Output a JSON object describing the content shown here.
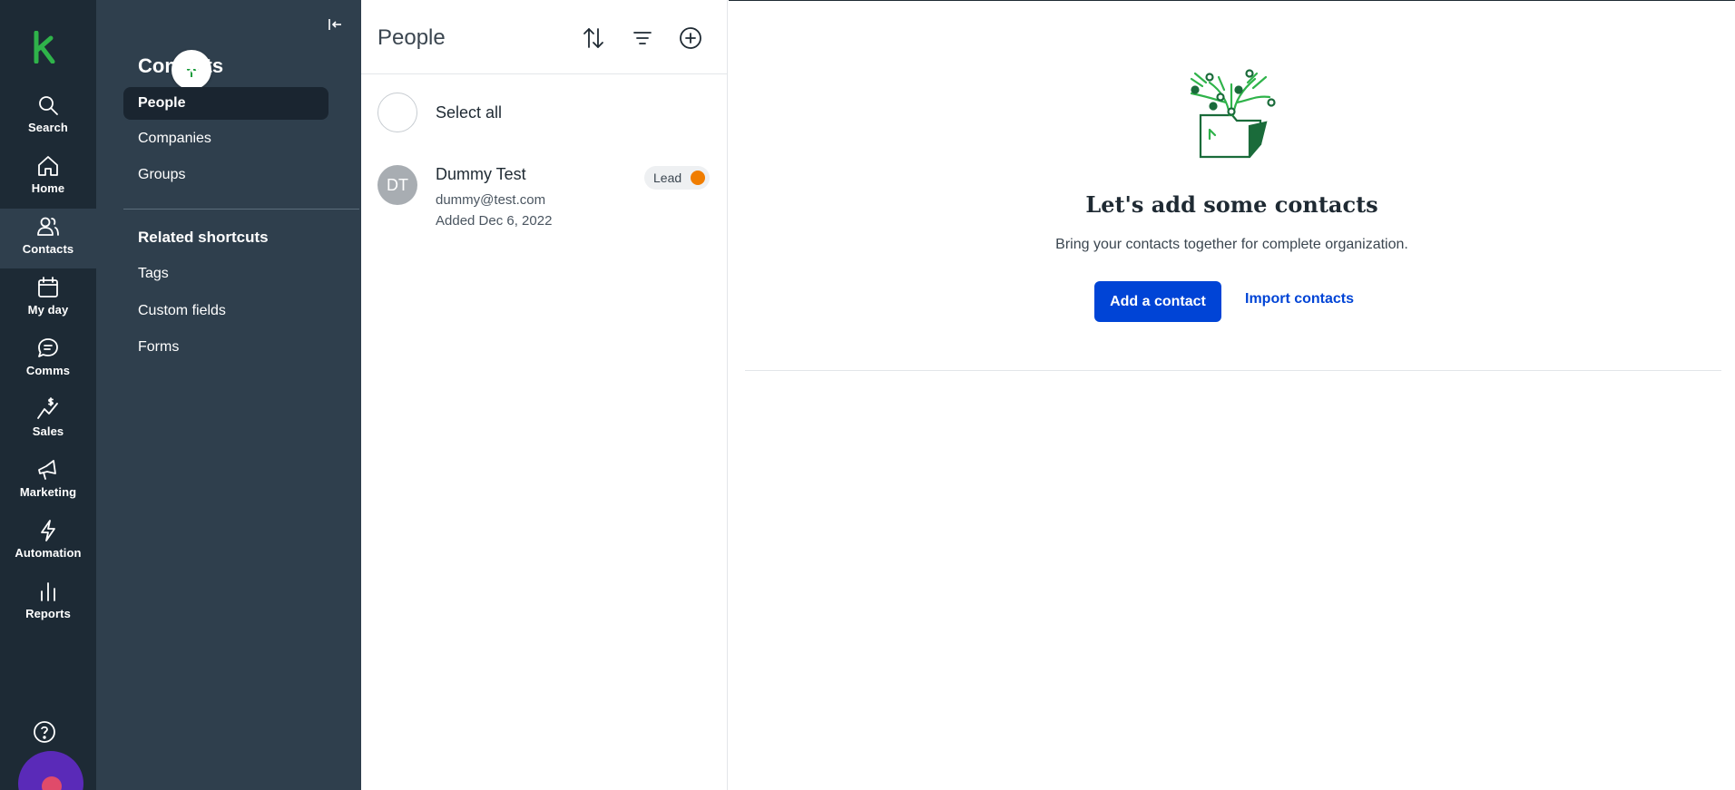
{
  "rail": {
    "items": [
      {
        "label": "Search",
        "icon": "search-icon"
      },
      {
        "label": "Home",
        "icon": "home-icon"
      },
      {
        "label": "Contacts",
        "icon": "contacts-icon",
        "active": true
      },
      {
        "label": "My day",
        "icon": "calendar-icon"
      },
      {
        "label": "Comms",
        "icon": "chat-icon"
      },
      {
        "label": "Sales",
        "icon": "sales-icon"
      },
      {
        "label": "Marketing",
        "icon": "megaphone-icon"
      },
      {
        "label": "Automation",
        "icon": "lightning-icon"
      },
      {
        "label": "Reports",
        "icon": "bar-chart-icon"
      }
    ],
    "help_icon": "help-icon"
  },
  "subnav": {
    "title": "Contacts",
    "links": [
      {
        "label": "People",
        "active": true
      },
      {
        "label": "Companies"
      },
      {
        "label": "Groups"
      }
    ],
    "shortcuts_heading": "Related shortcuts",
    "shortcuts": [
      {
        "label": "Tags"
      },
      {
        "label": "Custom fields"
      },
      {
        "label": "Forms"
      }
    ]
  },
  "list": {
    "title": "People",
    "select_all": "Select all",
    "contacts": [
      {
        "initials": "DT",
        "name": "Dummy Test",
        "email": "dummy@test.com",
        "added": "Added Dec 6, 2022",
        "badge": "Lead",
        "badge_color": "#f07d00"
      }
    ]
  },
  "main": {
    "empty_title": "Let's add some contacts",
    "empty_subtitle": "Bring your contacts together for complete organization.",
    "primary_button": "Add a contact",
    "secondary_link": "Import contacts"
  },
  "colors": {
    "rail_bg": "#1d2a35",
    "subnav_bg": "#2f3f4d",
    "brand_green": "#1a9c3c",
    "primary_blue": "#0044d6"
  }
}
